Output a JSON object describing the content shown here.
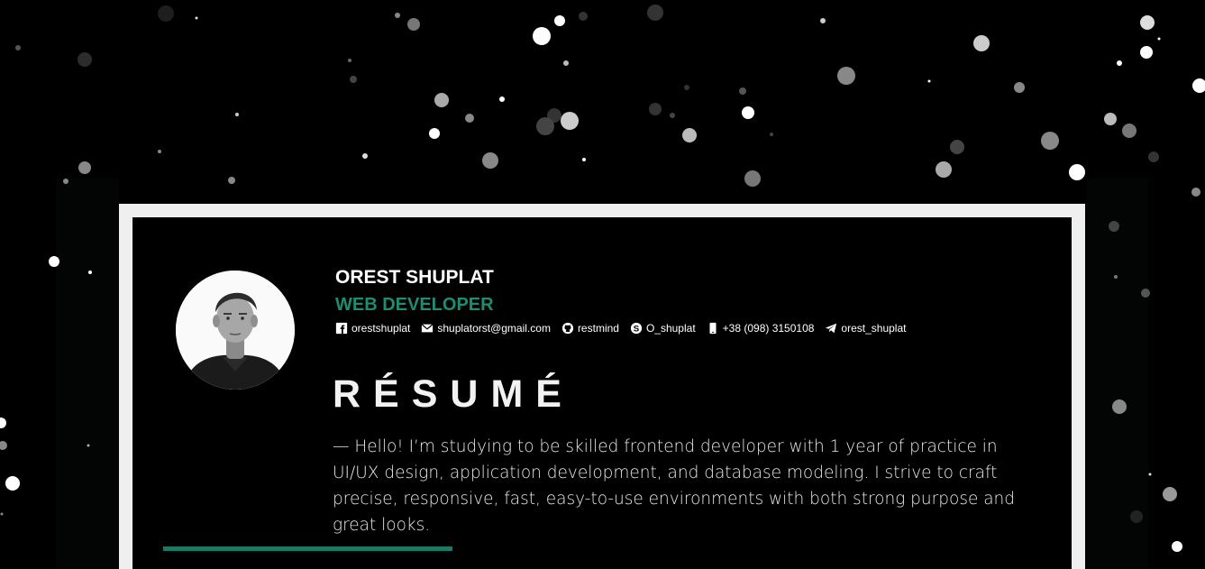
{
  "profile": {
    "name": "OREST SHUPLAT",
    "role": "WEB DEVELOPER",
    "avatar_alt": "Orest Shuplat portrait"
  },
  "contacts": [
    {
      "icon": "facebook-icon",
      "label": "orestshuplat"
    },
    {
      "icon": "email-icon",
      "label": "shuplatorst@gmail.com"
    },
    {
      "icon": "github-icon",
      "label": "restmind"
    },
    {
      "icon": "skype-icon",
      "label": "O_shuplat"
    },
    {
      "icon": "phone-icon",
      "label": "+38 (098) 3150108"
    },
    {
      "icon": "telegram-icon",
      "label": "orest_shuplat"
    }
  ],
  "resume": {
    "title": "RÉSUMÉ",
    "intro": "— Hello! I’m studying to be skilled frontend developer with 1 year of practice in UI/UX design, application development, and database modeling. I strive to craft precise, responsive, fast, easy-to-use environments with both strong purpose and great looks."
  },
  "colors": {
    "background": "#000000",
    "frame": "#efefef",
    "accent": "#1f8b6f",
    "text": "#ffffff"
  }
}
